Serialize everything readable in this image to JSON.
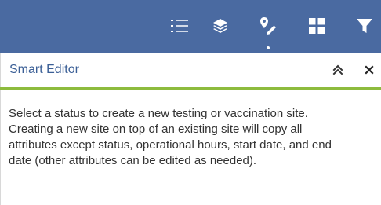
{
  "toolbar": {
    "background": "#4a6aa1",
    "icons": [
      {
        "name": "list-icon",
        "active": false
      },
      {
        "name": "layers-icon",
        "active": false
      },
      {
        "name": "edit-icon",
        "active": true
      },
      {
        "name": "grid-icon",
        "active": false
      },
      {
        "name": "filter-icon",
        "active": false
      }
    ]
  },
  "panel": {
    "title": "Smart Editor",
    "title_color": "#3b5f96",
    "accent_color": "#8dbb3d",
    "collapse_icon": "double-chevron-up-icon",
    "close_icon": "close-icon",
    "instructions": "Select a status to create a new testing or vaccination site. Creating a new site on top of an existing site will copy all attributes except status, operational hours, start date, and end date (other attributes can be edited as needed)."
  }
}
